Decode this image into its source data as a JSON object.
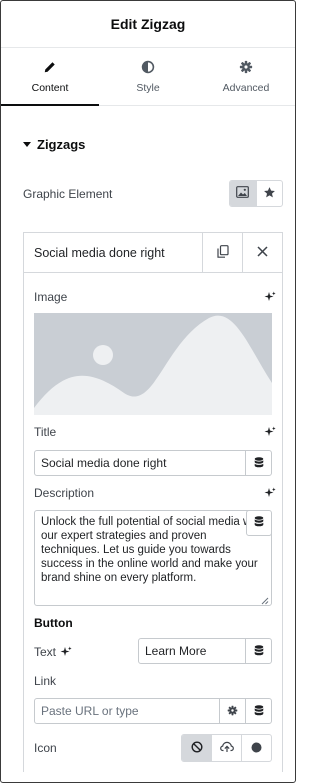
{
  "header": {
    "title": "Edit Zigzag"
  },
  "tabs": [
    {
      "label": "Content",
      "icon": "pencil-icon",
      "active": true
    },
    {
      "label": "Style",
      "icon": "half-circle-icon",
      "active": false
    },
    {
      "label": "Advanced",
      "icon": "gear-icon",
      "active": false
    }
  ],
  "section": {
    "title": "Zigzags"
  },
  "graphic_element": {
    "label": "Graphic Element",
    "options": [
      "image-icon",
      "star-icon"
    ],
    "selected": "image-icon"
  },
  "item": {
    "title": "Social media done right",
    "image_label": "Image",
    "title_label": "Title",
    "title_value": "Social media done right",
    "description_label": "Description",
    "description_value": "Unlock the full potential of social media with our expert strategies and proven techniques. Let us guide you towards success in the online world and make your brand shine on every platform.",
    "button_heading": "Button",
    "text_label": "Text",
    "text_value": "Learn More",
    "link_label": "Link",
    "link_placeholder": "Paste URL or type",
    "icon_label": "Icon",
    "icon_options": [
      "none-icon",
      "upload-icon",
      "circle-icon"
    ],
    "icon_selected": "none-icon"
  },
  "colors": {
    "accent": "#0c0d0e",
    "border": "#d5d8dc",
    "active_bg": "#d5d8dc",
    "placeholder_img": "#e8eaec"
  }
}
